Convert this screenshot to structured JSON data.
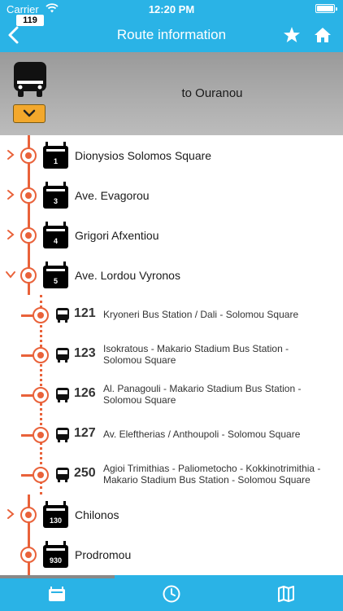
{
  "status_bar": {
    "carrier": "Carrier",
    "time": "12:20 PM"
  },
  "nav": {
    "title": "Route information",
    "back_icon": "chevron-left-icon",
    "favorite_icon": "star-icon",
    "home_icon": "home-icon"
  },
  "header": {
    "route_number": "119",
    "destination": "to Ouranou"
  },
  "stops": [
    {
      "number": "1",
      "name": "Dionysios Solomos Square",
      "expanded": false
    },
    {
      "number": "3",
      "name": "Ave. Evagorou",
      "expanded": false
    },
    {
      "number": "4",
      "name": "Grigori Afxentiou",
      "expanded": false
    },
    {
      "number": "5",
      "name": "Ave. Lordou Vyronos",
      "expanded": true
    },
    {
      "number": "130",
      "name": "Chilonos",
      "expanded": false
    },
    {
      "number": "930",
      "name": "Prodromou",
      "expanded": false
    }
  ],
  "connections": [
    {
      "route": "121",
      "line1": "Kryoneri Bus Station / Dali - Solomou Square",
      "line2": ""
    },
    {
      "route": "123",
      "line1": "Isokratous - Makario Stadium Bus Station -",
      "line2": "Solomou Square"
    },
    {
      "route": "126",
      "line1": "Al. Panagouli - Makario Stadium Bus Station -",
      "line2": "Solomou Square"
    },
    {
      "route": "127",
      "line1": "Av. Eleftherias / Anthoupoli - Solomou Square",
      "line2": ""
    },
    {
      "route": "250",
      "line1": "Agioi Trimithias - Paliometocho - Kokkinotrimithia -",
      "line2": "Makario Stadium Bus Station - Solomou Square"
    }
  ],
  "tabs": [
    {
      "icon": "bus-stop-icon",
      "active": true
    },
    {
      "icon": "clock-icon",
      "active": false
    },
    {
      "icon": "map-icon",
      "active": false
    }
  ],
  "colors": {
    "accent": "#2ab3e6",
    "route_line": "#e9623a",
    "dropdown": "#f3a82c"
  }
}
